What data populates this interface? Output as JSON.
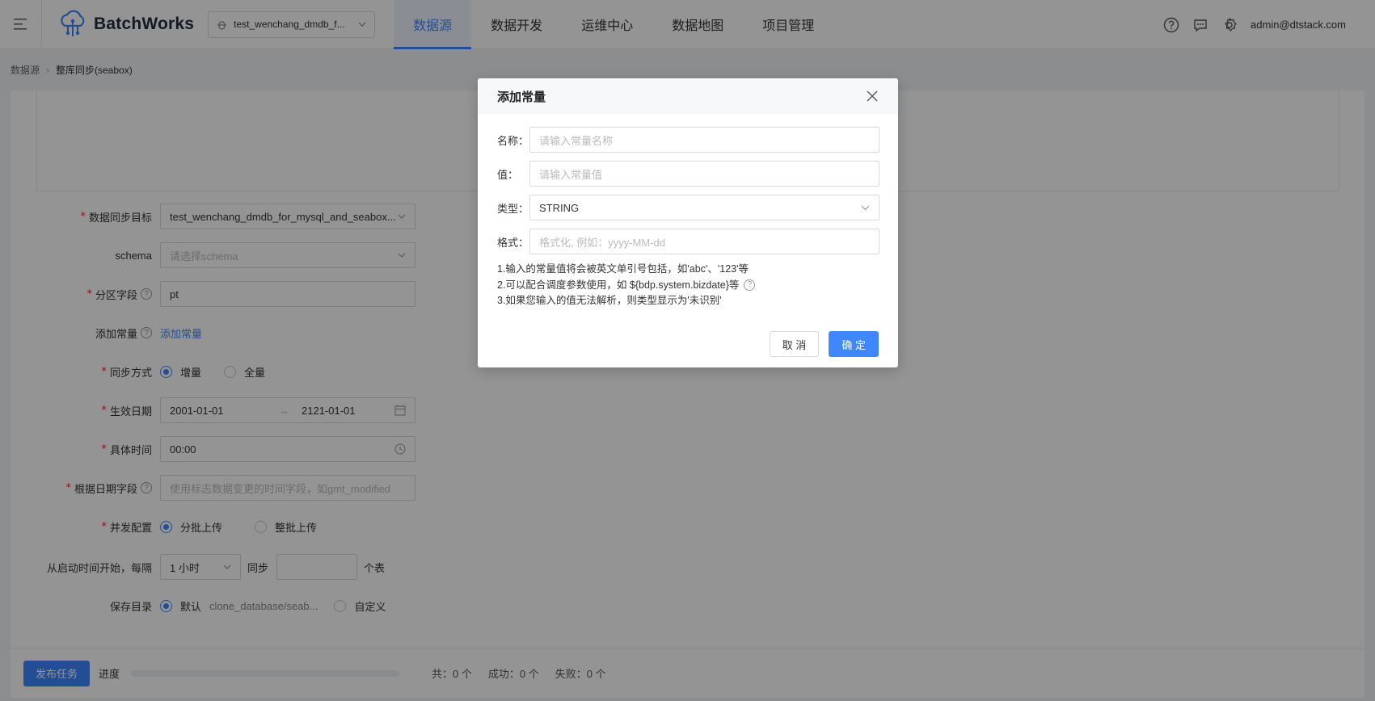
{
  "app": {
    "brand": "BatchWorks",
    "project": "test_wenchang_dmdb_f..."
  },
  "nav": {
    "items": [
      "数据源",
      "数据开发",
      "运维中心",
      "数据地图",
      "项目管理"
    ]
  },
  "header": {
    "user": "admin@dtstack.com"
  },
  "breadcrumb": {
    "root": "数据源",
    "current": "整库同步(seabox)"
  },
  "form": {
    "target_label": "数据同步目标",
    "target_value": "test_wenchang_dmdb_for_mysql_and_seabox...",
    "schema_label": "schema",
    "schema_placeholder": "请选择schema",
    "partition_label": "分区字段",
    "partition_value": "pt",
    "constant_label": "添加常量",
    "constant_link": "添加常量",
    "sync_mode_label": "同步方式",
    "sync_mode_options": [
      "增量",
      "全量"
    ],
    "date_label": "生效日期",
    "date_start": "2001-01-01",
    "date_end": "2121-01-01",
    "time_label": "具体时间",
    "time_value": "00:00",
    "date_field_label": "根据日期字段",
    "date_field_placeholder": "使用标志数据变更的时间字段，如gmt_modified",
    "concurrency_label": "并发配置",
    "concurrency_options": [
      "分批上传",
      "整批上传"
    ],
    "interval_label": "从启动时间开始，每隔",
    "interval_value": "1 小时",
    "interval_mid": "同步",
    "interval_unit": "个表",
    "save_dir_label": "保存目录",
    "save_dir_default": "默认",
    "save_dir_path": "clone_database/seab...",
    "save_dir_custom": "自定义"
  },
  "footer": {
    "publish": "发布任务",
    "progress_label": "进度",
    "progress_value": 0,
    "total": "共：0 个",
    "success": "成功：0 个",
    "failed": "失败：0 个"
  },
  "modal": {
    "title": "添加常量",
    "name_label": "名称：",
    "name_placeholder": "请输入常量名称",
    "value_label": "值：",
    "value_placeholder": "请输入常量值",
    "type_label": "类型：",
    "type_value": "STRING",
    "format_label": "格式：",
    "format_placeholder": "格式化, 例如：yyyy-MM-dd",
    "note1": "1.输入的常量值将会被英文单引号包括，如'abc'、'123'等",
    "note2": "2.可以配合调度参数使用，如 ${bdp.system.bizdate}等",
    "note3": "3.如果您输入的值无法解析，则类型显示为'未识别'",
    "cancel": "取 消",
    "ok": "确 定"
  },
  "colors": {
    "primary": "#3f87ff",
    "required": "#f5222d"
  }
}
